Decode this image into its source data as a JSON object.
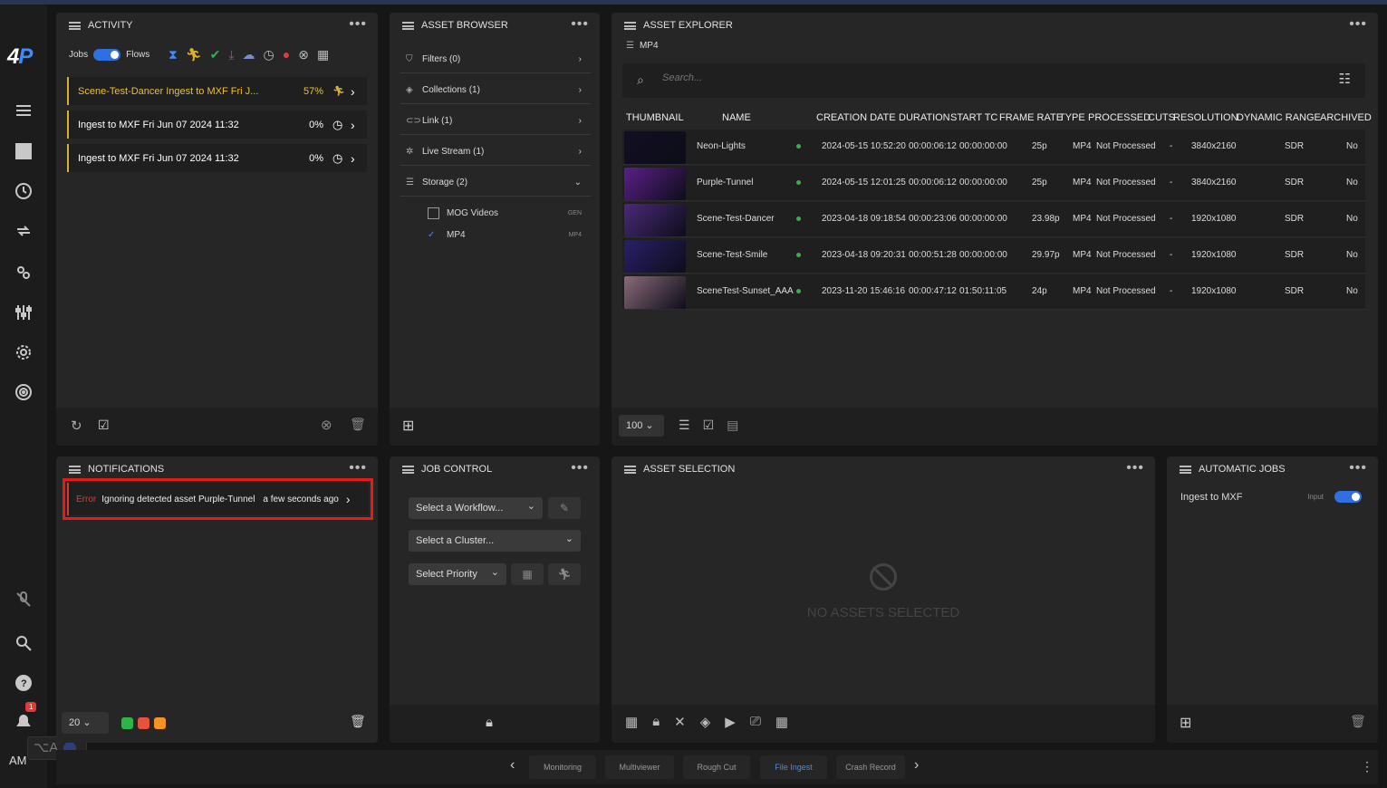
{
  "sidebar": {
    "logo": "4P",
    "notification_count": "1",
    "user_initials": "AM",
    "shortcut_hint": "⌥A"
  },
  "activity": {
    "title": "ACTIVITY",
    "jobs_label": "Jobs",
    "flows_label": "Flows",
    "jobs": [
      {
        "name": "Scene-Test-Dancer  Ingest to MXF Fri J...",
        "progress": "57%",
        "state": "running"
      },
      {
        "name": "Ingest to MXF Fri Jun 07 2024 11:32",
        "progress": "0%",
        "state": "queued"
      },
      {
        "name": "Ingest to MXF Fri Jun 07 2024 11:32",
        "progress": "0%",
        "state": "queued"
      }
    ]
  },
  "asset_browser": {
    "title": "ASSET BROWSER",
    "rows": [
      {
        "label": "Filters (0)",
        "icon": "filter-icon"
      },
      {
        "label": "Collections (1)",
        "icon": "layers-icon"
      },
      {
        "label": "Link (1)",
        "icon": "link-icon"
      },
      {
        "label": "Live Stream (1)",
        "icon": "broadcast-icon"
      },
      {
        "label": "Storage (2)",
        "icon": "storage-icon"
      }
    ],
    "storage": [
      {
        "label": "MOG Videos",
        "tag": "GEN",
        "checked": false
      },
      {
        "label": "MP4",
        "tag": "MP4",
        "checked": true
      }
    ]
  },
  "asset_explorer": {
    "title": "ASSET EXPLORER",
    "path": "MP4",
    "search_placeholder": "Search...",
    "columns": [
      "THUMBNAIL",
      "NAME",
      "CREATION DATE",
      "DURATION",
      "START TC",
      "FRAME RATE",
      "TYPE",
      "PROCESSED",
      "CUTS",
      "RESOLUTION",
      "DYNAMIC RANGE",
      "ARCHIVED"
    ],
    "rows": [
      {
        "name": "Neon-Lights",
        "date": "2024-05-15 10:52:20",
        "duration": "00:00:06:12",
        "start_tc": "00:00:00:00",
        "fps": "25p",
        "type": "MP4",
        "processed": "Not Processed",
        "cuts": "-",
        "res": "3840x2160",
        "range": "SDR",
        "archived": "No",
        "thumb": "#120f22"
      },
      {
        "name": "Purple-Tunnel",
        "date": "2024-05-15 12:01:25",
        "duration": "00:00:06:12",
        "start_tc": "00:00:00:00",
        "fps": "25p",
        "type": "MP4",
        "processed": "Not Processed",
        "cuts": "-",
        "res": "3840x2160",
        "range": "SDR",
        "archived": "No",
        "thumb": "#5b1f8a"
      },
      {
        "name": "Scene-Test-Dancer",
        "date": "2023-04-18 09:18:54",
        "duration": "00:00:23:06",
        "start_tc": "00:00:00:00",
        "fps": "23.98p",
        "type": "MP4",
        "processed": "Not Processed",
        "cuts": "-",
        "res": "1920x1080",
        "range": "SDR",
        "archived": "No",
        "thumb": "#4a2a7a"
      },
      {
        "name": "Scene-Test-Smile",
        "date": "2023-04-18 09:20:31",
        "duration": "00:00:51:28",
        "start_tc": "00:00:00:00",
        "fps": "29.97p",
        "type": "MP4",
        "processed": "Not Processed",
        "cuts": "-",
        "res": "1920x1080",
        "range": "SDR",
        "archived": "No",
        "thumb": "#2a1f6a"
      },
      {
        "name": "SceneTest-Sunset_AAA",
        "date": "2023-11-20 15:46:16",
        "duration": "00:00:47:12",
        "start_tc": "01:50:11:05",
        "fps": "24p",
        "type": "MP4",
        "processed": "Not Processed",
        "cuts": "-",
        "res": "1920x1080",
        "range": "SDR",
        "archived": "No",
        "thumb": "#8a6a7a"
      }
    ],
    "page_size": "100"
  },
  "notifications": {
    "title": "NOTIFICATIONS",
    "items": [
      {
        "level": "Error",
        "message": "Ignoring detected asset Purple-Tunnel",
        "time": "a few seconds ago"
      }
    ],
    "page_size": "20"
  },
  "job_control": {
    "title": "JOB CONTROL",
    "workflow_placeholder": "Select a Workflow...",
    "cluster_placeholder": "Select a Cluster...",
    "priority_placeholder": "Select Priority"
  },
  "asset_selection": {
    "title": "ASSET SELECTION",
    "empty_text": "NO ASSETS SELECTED"
  },
  "automatic_jobs": {
    "title": "AUTOMATIC JOBS",
    "items": [
      {
        "label": "Ingest to MXF",
        "tag": "Input",
        "enabled": true
      }
    ]
  },
  "bottom_tabs": {
    "items": [
      "Monitoring",
      "Multiviewer",
      "Rough Cut",
      "File Ingest",
      "Crash Record"
    ],
    "active": "File Ingest"
  },
  "colors": {
    "accent": "#3b8cff",
    "running": "#d9b22b",
    "error": "#e41b1b",
    "ok": "#2fb34a"
  }
}
